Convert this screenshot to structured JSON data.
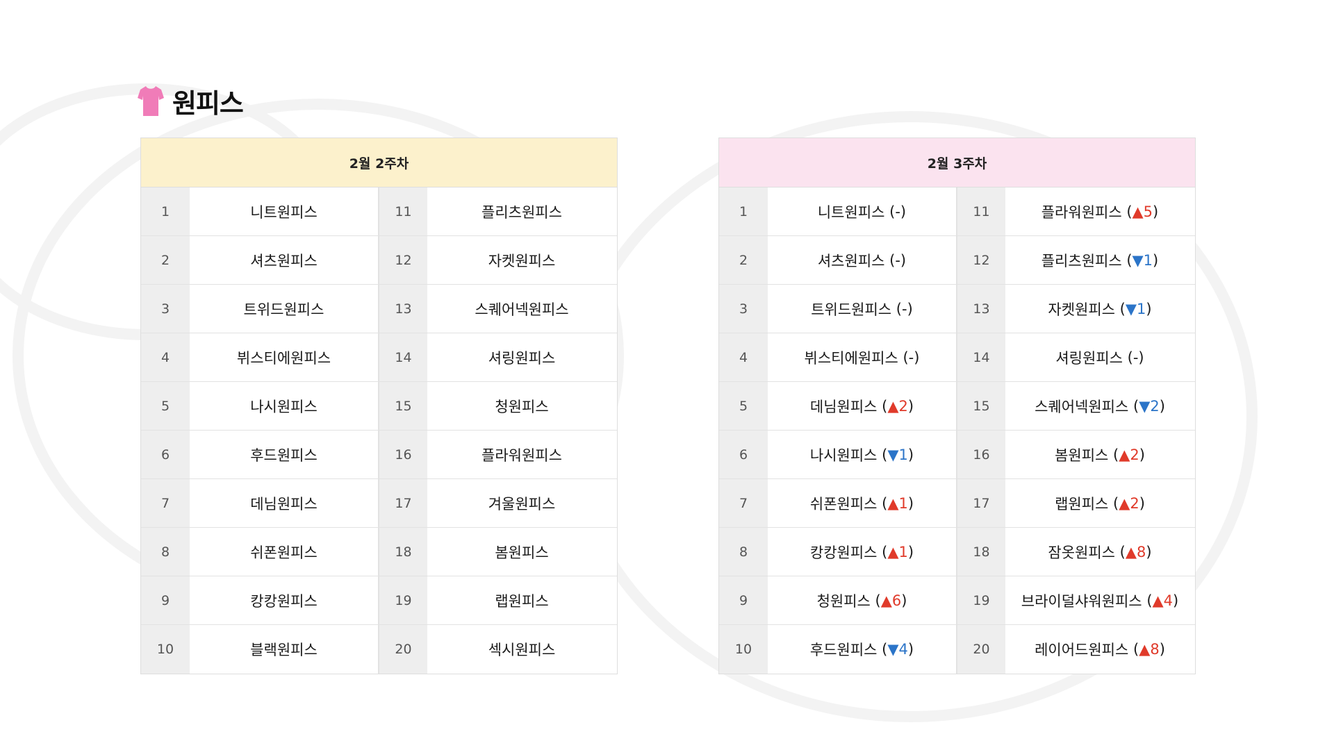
{
  "page": {
    "title": "원피스",
    "icon": "dress-icon",
    "accent_color": "#f07cb8"
  },
  "colors": {
    "week_left_header_bg": "#fcf1cc",
    "week_right_header_bg": "#fbe3ef",
    "rise": "#e03a2a",
    "fall": "#2b74c8"
  },
  "week_left": {
    "title": "2월 2주차",
    "rows": [
      {
        "rank_a": "1",
        "name_a": "니트원피스",
        "rank_b": "11",
        "name_b": "플리츠원피스"
      },
      {
        "rank_a": "2",
        "name_a": "셔츠원피스",
        "rank_b": "12",
        "name_b": "자켓원피스"
      },
      {
        "rank_a": "3",
        "name_a": "트위드원피스",
        "rank_b": "13",
        "name_b": "스퀘어넥원피스"
      },
      {
        "rank_a": "4",
        "name_a": "뷔스티에원피스",
        "rank_b": "14",
        "name_b": "셔링원피스"
      },
      {
        "rank_a": "5",
        "name_a": "나시원피스",
        "rank_b": "15",
        "name_b": "청원피스"
      },
      {
        "rank_a": "6",
        "name_a": "후드원피스",
        "rank_b": "16",
        "name_b": "플라워원피스"
      },
      {
        "rank_a": "7",
        "name_a": "데님원피스",
        "rank_b": "17",
        "name_b": "겨울원피스"
      },
      {
        "rank_a": "8",
        "name_a": "쉬폰원피스",
        "rank_b": "18",
        "name_b": "봄원피스"
      },
      {
        "rank_a": "9",
        "name_a": "캉캉원피스",
        "rank_b": "19",
        "name_b": "랩원피스"
      },
      {
        "rank_a": "10",
        "name_a": "블랙원피스",
        "rank_b": "20",
        "name_b": "섹시원피스"
      }
    ]
  },
  "week_right": {
    "title": "2월 3주차",
    "rows": [
      {
        "rank_a": "1",
        "name_a": "니트원피스",
        "change_a": "-",
        "rank_b": "11",
        "name_b": "플라워원피스",
        "change_b": "▲5"
      },
      {
        "rank_a": "2",
        "name_a": "셔츠원피스",
        "change_a": "-",
        "rank_b": "12",
        "name_b": "플리츠원피스",
        "change_b": "▼1"
      },
      {
        "rank_a": "3",
        "name_a": "트위드원피스",
        "change_a": "-",
        "rank_b": "13",
        "name_b": "자켓원피스",
        "change_b": "▼1"
      },
      {
        "rank_a": "4",
        "name_a": "뷔스티에원피스",
        "change_a": "-",
        "rank_b": "14",
        "name_b": "셔링원피스",
        "change_b": "-"
      },
      {
        "rank_a": "5",
        "name_a": "데님원피스",
        "change_a": "▲2",
        "rank_b": "15",
        "name_b": "스퀘어넥원피스",
        "change_b": "▼2"
      },
      {
        "rank_a": "6",
        "name_a": "나시원피스",
        "change_a": "▼1",
        "rank_b": "16",
        "name_b": "봄원피스",
        "change_b": "▲2"
      },
      {
        "rank_a": "7",
        "name_a": "쉬폰원피스",
        "change_a": "▲1",
        "rank_b": "17",
        "name_b": "랩원피스",
        "change_b": "▲2"
      },
      {
        "rank_a": "8",
        "name_a": "캉캉원피스",
        "change_a": "▲1",
        "rank_b": "18",
        "name_b": "잠옷원피스",
        "change_b": "▲8"
      },
      {
        "rank_a": "9",
        "name_a": "청원피스",
        "change_a": "▲6",
        "rank_b": "19",
        "name_b": "브라이덜샤워원피스",
        "change_b": "▲4"
      },
      {
        "rank_a": "10",
        "name_a": "후드원피스",
        "change_a": "▼4",
        "rank_b": "20",
        "name_b": "레이어드원피스",
        "change_b": "▲8"
      }
    ]
  }
}
